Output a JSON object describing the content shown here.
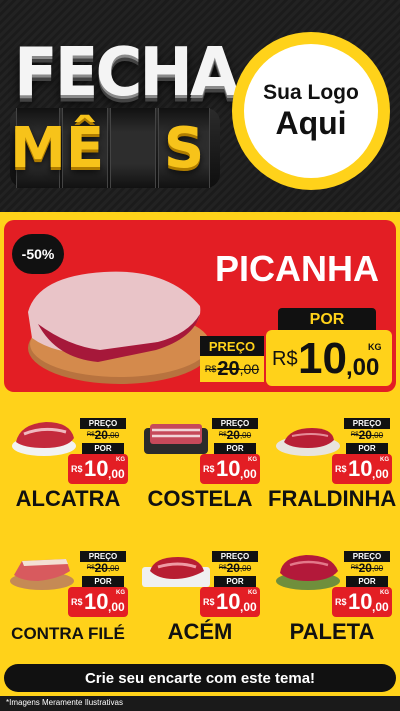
{
  "header": {
    "title_line1": "FECHA",
    "title_line2_letters": [
      "M",
      "Ê",
      "S"
    ],
    "logo_line1": "Sua Logo",
    "logo_line2": "Aqui"
  },
  "hero": {
    "badge": "-50%",
    "product": "PICANHA",
    "preco_label": "PREÇO",
    "old_currency": "R$",
    "old_integer": "20",
    "old_decimal": ",00",
    "por_label": "POR",
    "currency": "R$",
    "price_integer": "10",
    "price_decimal": ",00",
    "unit": "KG"
  },
  "products": [
    {
      "name": "ALCATRA",
      "preco_label": "PREÇO",
      "old_currency": "R$",
      "old_integer": "20",
      "old_decimal": ",00",
      "por_label": "POR",
      "currency": "R$",
      "price_integer": "10",
      "price_decimal": ",00",
      "unit": "KG"
    },
    {
      "name": "COSTELA",
      "preco_label": "PREÇO",
      "old_currency": "R$",
      "old_integer": "20",
      "old_decimal": ",00",
      "por_label": "POR",
      "currency": "R$",
      "price_integer": "10",
      "price_decimal": ",00",
      "unit": "KG"
    },
    {
      "name": "FRALDINHA",
      "preco_label": "PREÇO",
      "old_currency": "R$",
      "old_integer": "20",
      "old_decimal": ",00",
      "por_label": "POR",
      "currency": "R$",
      "price_integer": "10",
      "price_decimal": ",00",
      "unit": "KG"
    },
    {
      "name": "CONTRA FILÉ",
      "preco_label": "PREÇO",
      "old_currency": "R$",
      "old_integer": "20",
      "old_decimal": ",00",
      "por_label": "POR",
      "currency": "R$",
      "price_integer": "10",
      "price_decimal": ",00",
      "unit": "KG"
    },
    {
      "name": "ACÉM",
      "preco_label": "PREÇO",
      "old_currency": "R$",
      "old_integer": "20",
      "old_decimal": ",00",
      "por_label": "POR",
      "currency": "R$",
      "price_integer": "10",
      "price_decimal": ",00",
      "unit": "KG"
    },
    {
      "name": "PALETA",
      "preco_label": "PREÇO",
      "old_currency": "R$",
      "old_integer": "20",
      "old_decimal": ",00",
      "por_label": "POR",
      "currency": "R$",
      "price_integer": "10",
      "price_decimal": ",00",
      "unit": "KG"
    }
  ],
  "footer": {
    "cta": "Crie seu encarte com este tema!",
    "disclaimer": "*Imagens Meramente Ilustrativas"
  },
  "colors": {
    "yellow": "#ffd21a",
    "red": "#e31e24",
    "black": "#111111"
  }
}
